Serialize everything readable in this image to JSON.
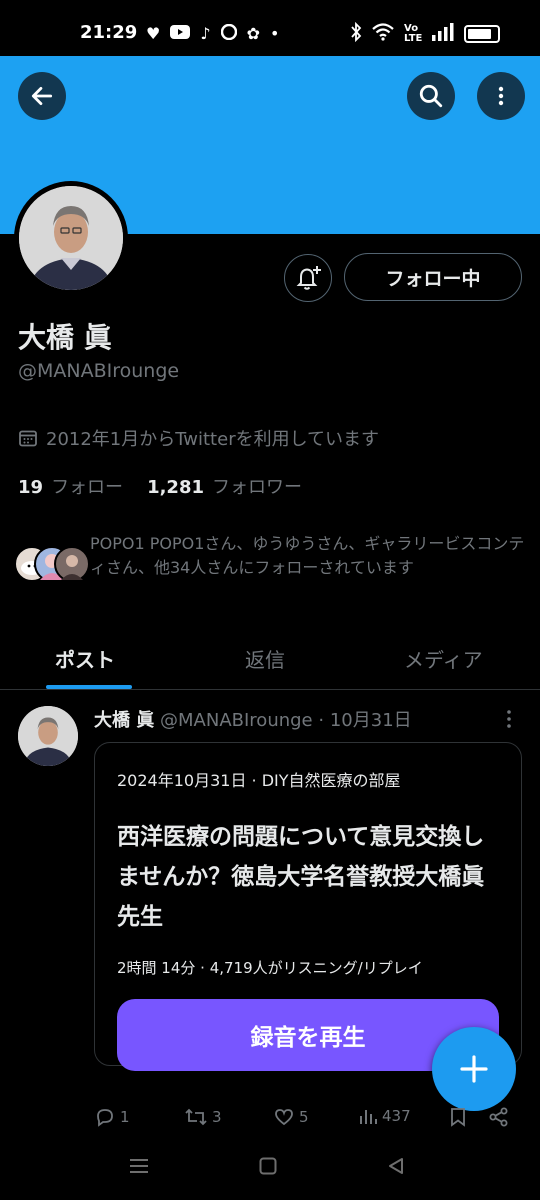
{
  "status_bar": {
    "time": "21:29",
    "network_label": "Vo LTE",
    "notification_icons": [
      "heart-icon",
      "youtube-icon",
      "tiktok-icon",
      "dazn-icon",
      "app-icon",
      "dot-icon"
    ]
  },
  "profile": {
    "name": "大橋 眞",
    "handle": "@MANABIrounge",
    "joined": "2012年1月からTwitterを利用しています",
    "following_count": "19",
    "following_label": "フォロー",
    "followers_count": "1,281",
    "followers_label": "フォロワー",
    "follow_button": "フォロー中",
    "followed_by": "POPO1 POPO1さん、ゆうゆうさん、ギャラリービスコンティさん、他34人さんにフォローされています"
  },
  "tabs": [
    {
      "label": "ポスト",
      "active": true
    },
    {
      "label": "返信",
      "active": false
    },
    {
      "label": "メディア",
      "active": false
    }
  ],
  "post": {
    "author": "大橋 眞",
    "handle": "@MANABIrounge",
    "separator": "·",
    "date": "10月31日",
    "card": {
      "meta": "2024年10月31日 · DIY自然医療の部屋",
      "title": "西洋医療の問題について意見交換しませんか？徳島大学名誉教授大橋眞先生",
      "subtitle": "2時間 14分 · 4,719人がリスニング/リプレイ",
      "play_label": "録音を再生"
    },
    "actions": {
      "replies": "1",
      "reposts": "3",
      "likes": "5",
      "views": "437"
    }
  },
  "colors": {
    "banner": "#1da1f2",
    "accent": "#1d9bf0",
    "spaces_purple": "#7856ff",
    "background": "#000000",
    "secondary_text": "#71767b"
  }
}
